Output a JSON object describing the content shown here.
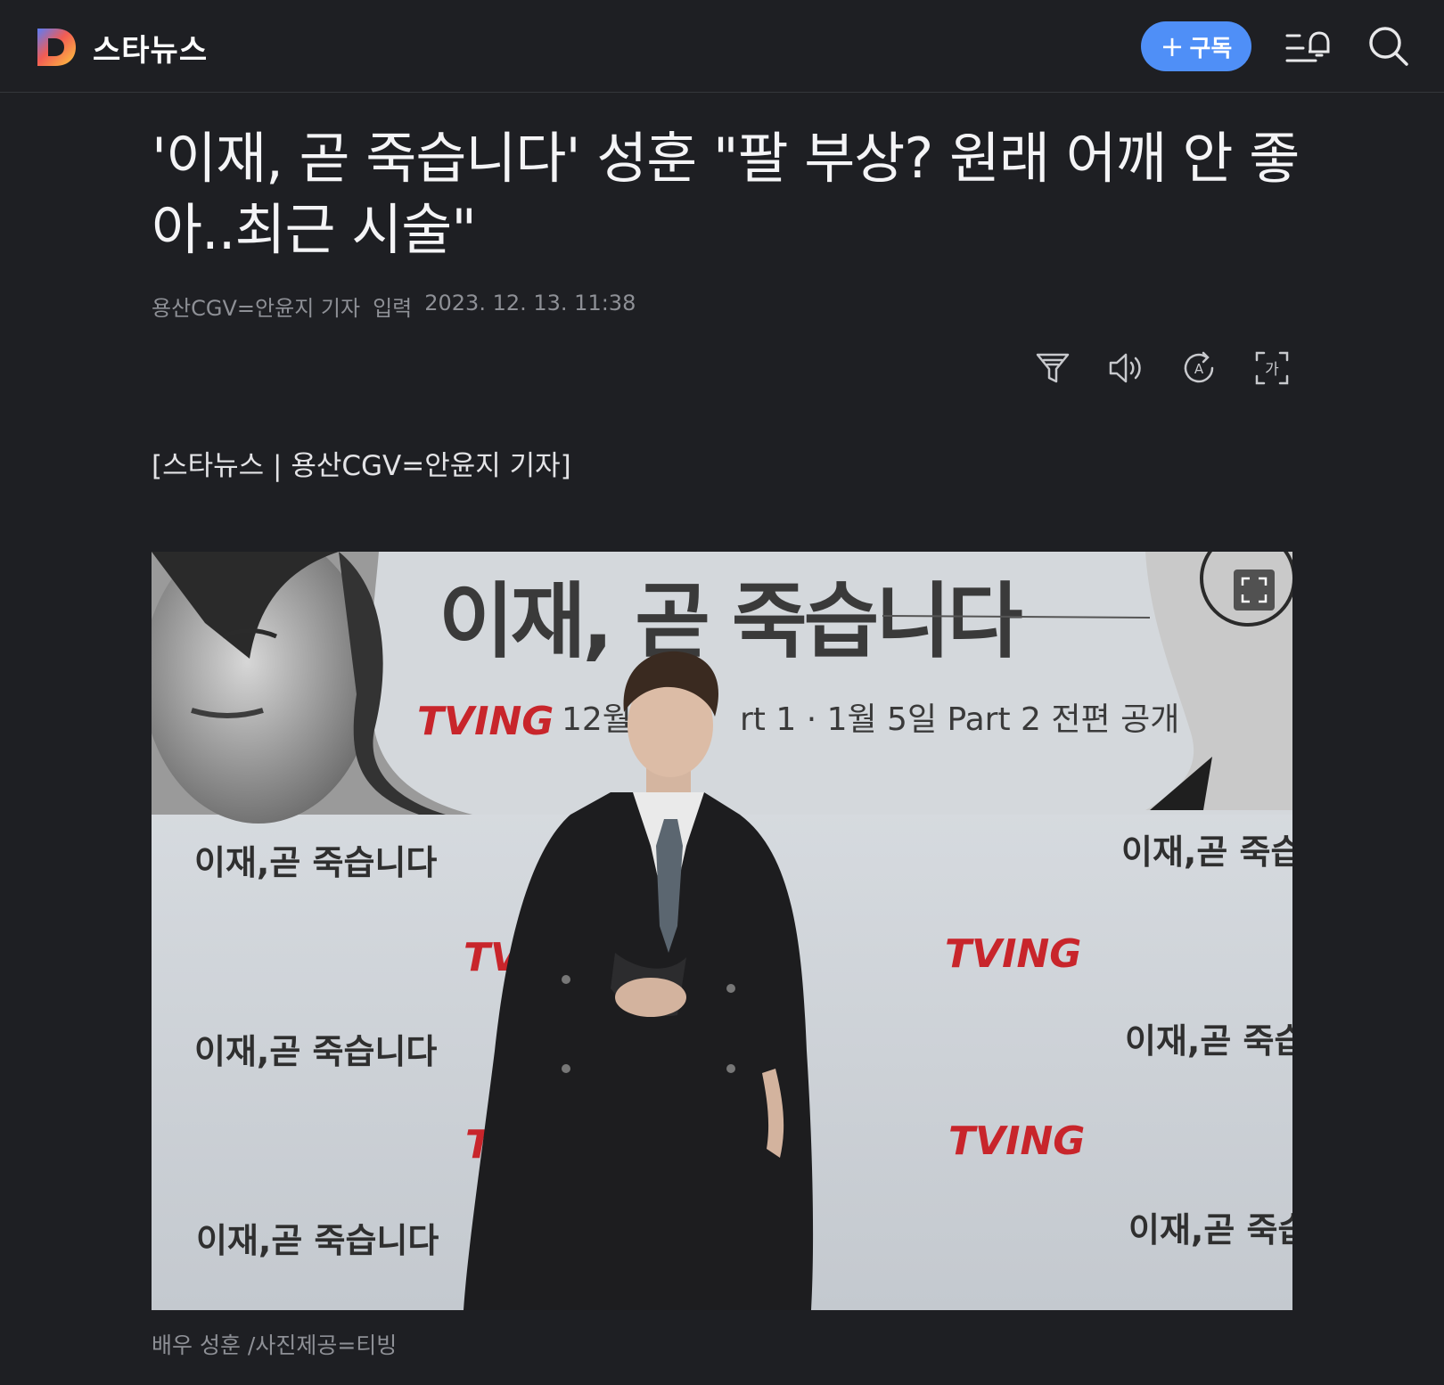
{
  "header": {
    "brand": "스타뉴스",
    "subscribe_label": "구독",
    "subscribe_plus": "+",
    "accent": "#4f8ff7"
  },
  "article": {
    "title": "'이재, 곧 죽습니다' 성훈 \"팔 부상? 원래 어깨 안 좋아..최근 시술\"",
    "reporter": "용산CGV=안윤지 기자",
    "input_label": "입력",
    "datetime": "2023. 12. 13. 11:38",
    "lead": "[스타뉴스 | 용산CGV=안윤지 기자]",
    "photo": {
      "poster_title": "이재, 곧 죽습니다",
      "tving": "TVING",
      "schedule": "12월 1",
      "schedule2": "rt 1 · 1월 5일 Part 2 전편 공개",
      "repeat_text": "이재,곧 죽습니다"
    },
    "caption": "배우 성훈 /사진제공=티빙"
  },
  "icons": {
    "logo": "daum-logo-icon",
    "notify": "menu-bell-icon",
    "search": "search-icon",
    "tools": [
      "summary-icon",
      "speaker-icon",
      "translate-icon",
      "font-size-icon"
    ],
    "expand": "fullscreen-icon"
  }
}
